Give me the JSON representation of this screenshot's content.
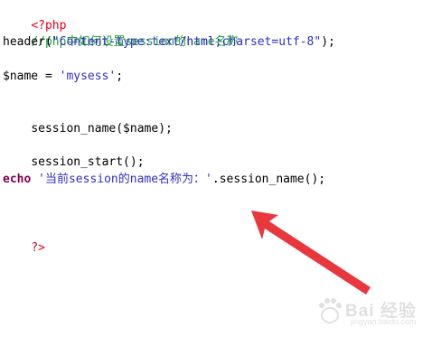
{
  "code": {
    "line1": {
      "php_open": "<?php"
    },
    "line2": {
      "comment": "//php中如何设置session的name名称"
    },
    "line3": {
      "func": "header(",
      "string": "\"Content-type:text/html;charset=utf-8\"",
      "end": ");"
    },
    "line5": {
      "var": "$name = ",
      "string": "'mysess'",
      "end": ";"
    },
    "line7": {
      "text": "session_name($name);"
    },
    "line9": {
      "text": "session_start();"
    },
    "line11": {
      "keyword": "echo",
      "space": " ",
      "string": "'当前session的name名称为：'",
      "rest": ".session_name();"
    },
    "line14": {
      "php_close": "?>"
    }
  },
  "colors": {
    "php_tag": "#e8001c",
    "comment": "#1c9a3b",
    "string": "#2f2fc2",
    "keyword": "#7d004d",
    "arrow": "#e8383d"
  },
  "watermark": {
    "brand": "Bai 经验",
    "url": "jingyan.baidu.com"
  }
}
